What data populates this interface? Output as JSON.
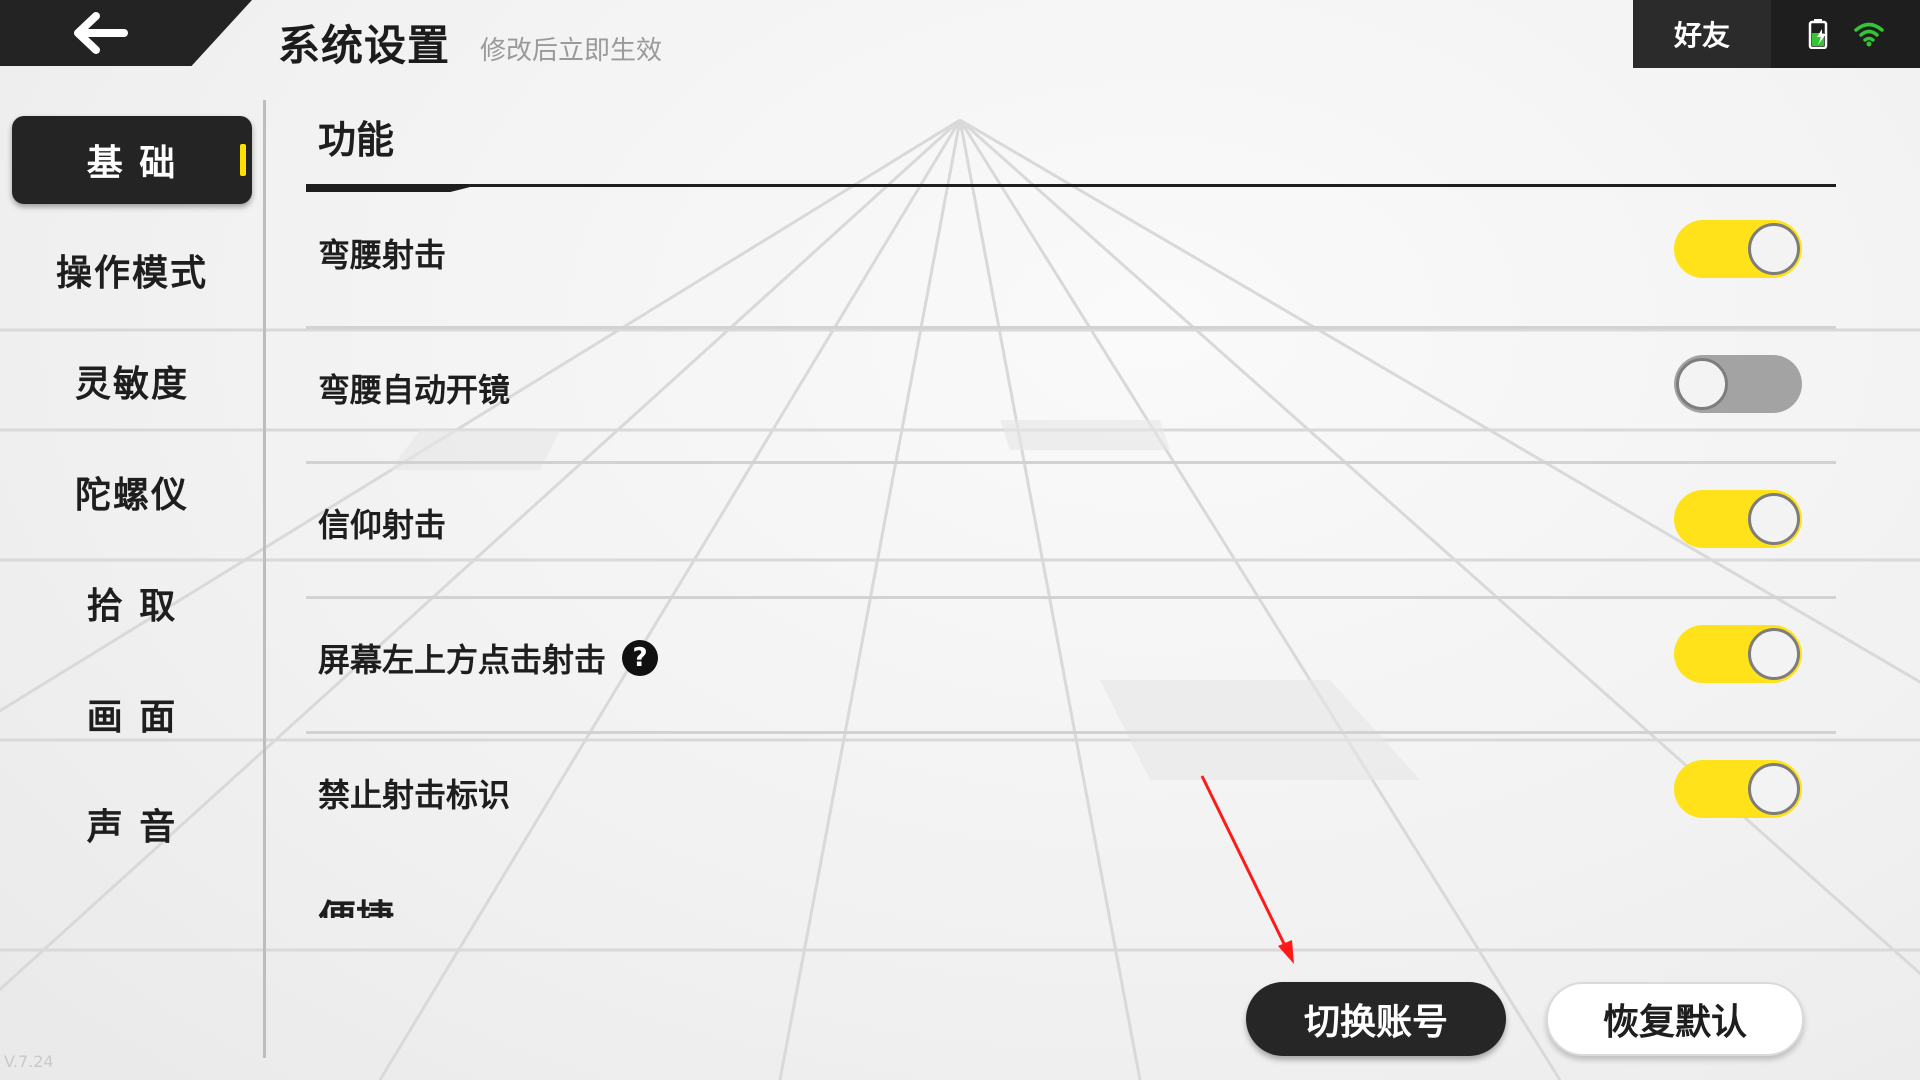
{
  "header": {
    "title": "系统设置",
    "subtitle": "修改后立即生效",
    "friend_label": "好友"
  },
  "sidebar": {
    "items": [
      {
        "label": "基 础",
        "active": true
      },
      {
        "label": "操作模式",
        "active": false
      },
      {
        "label": "灵敏度",
        "active": false
      },
      {
        "label": "陀螺仪",
        "active": false
      },
      {
        "label": "拾 取",
        "active": false
      },
      {
        "label": "画 面",
        "active": false
      },
      {
        "label": "声 音",
        "active": false
      }
    ]
  },
  "section": {
    "title": "功能",
    "next_title": "便捷"
  },
  "settings": [
    {
      "label": "弯腰射击",
      "enabled": true
    },
    {
      "label": "弯腰自动开镜",
      "enabled": false
    },
    {
      "label": "信仰射击",
      "enabled": true
    },
    {
      "label": "屏幕左上方点击射击",
      "enabled": true,
      "help": "?"
    },
    {
      "label": "禁止射击标识",
      "enabled": true
    }
  ],
  "buttons": {
    "switch_account": "切换账号",
    "restore_default": "恢复默认"
  },
  "version": "V.7.24",
  "colors": {
    "accent_yellow": "#ffe21a",
    "dark": "#242424",
    "annotation_red": "#ff1a1a",
    "wifi_green": "#35c435"
  }
}
